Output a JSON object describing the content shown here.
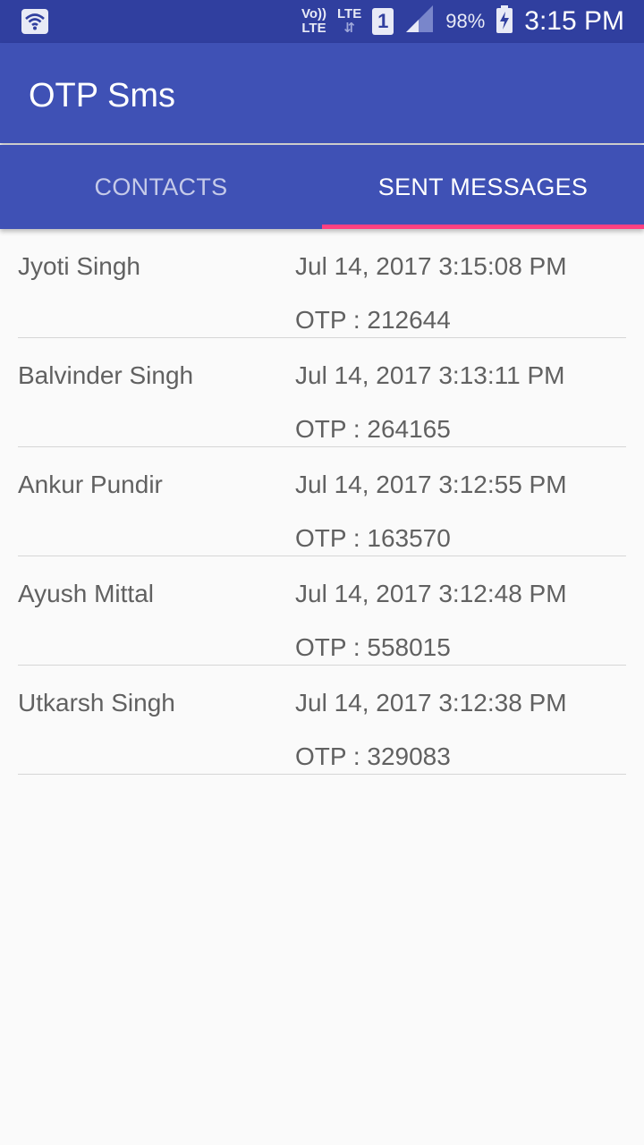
{
  "status_bar": {
    "volte_top": "Vo))",
    "volte_bottom": "LTE",
    "lte_label": "LTE",
    "lte_arrows": "⇵",
    "sim_slot": "1",
    "battery": "98%",
    "time": "3:15 PM",
    "icons": [
      "wifi-icon",
      "signal-icon",
      "battery-charging-icon"
    ]
  },
  "app_bar": {
    "title": "OTP Sms"
  },
  "tabs": [
    {
      "label": "CONTACTS",
      "active": false
    },
    {
      "label": "SENT MESSAGES",
      "active": true
    }
  ],
  "colors": {
    "primary": "#3f51b5",
    "primary_dark": "#303f9f",
    "accent": "#ff4081"
  },
  "messages": [
    {
      "name": "Jyoti Singh",
      "date": "Jul 14, 2017 3:15:08 PM",
      "otp": "OTP : 212644"
    },
    {
      "name": "Balvinder Singh",
      "date": "Jul 14, 2017 3:13:11 PM",
      "otp": "OTP : 264165"
    },
    {
      "name": "Ankur Pundir",
      "date": "Jul 14, 2017 3:12:55 PM",
      "otp": "OTP : 163570"
    },
    {
      "name": "Ayush Mittal",
      "date": "Jul 14, 2017 3:12:48 PM",
      "otp": "OTP : 558015"
    },
    {
      "name": "Utkarsh Singh",
      "date": "Jul 14, 2017 3:12:38 PM",
      "otp": "OTP : 329083"
    }
  ]
}
